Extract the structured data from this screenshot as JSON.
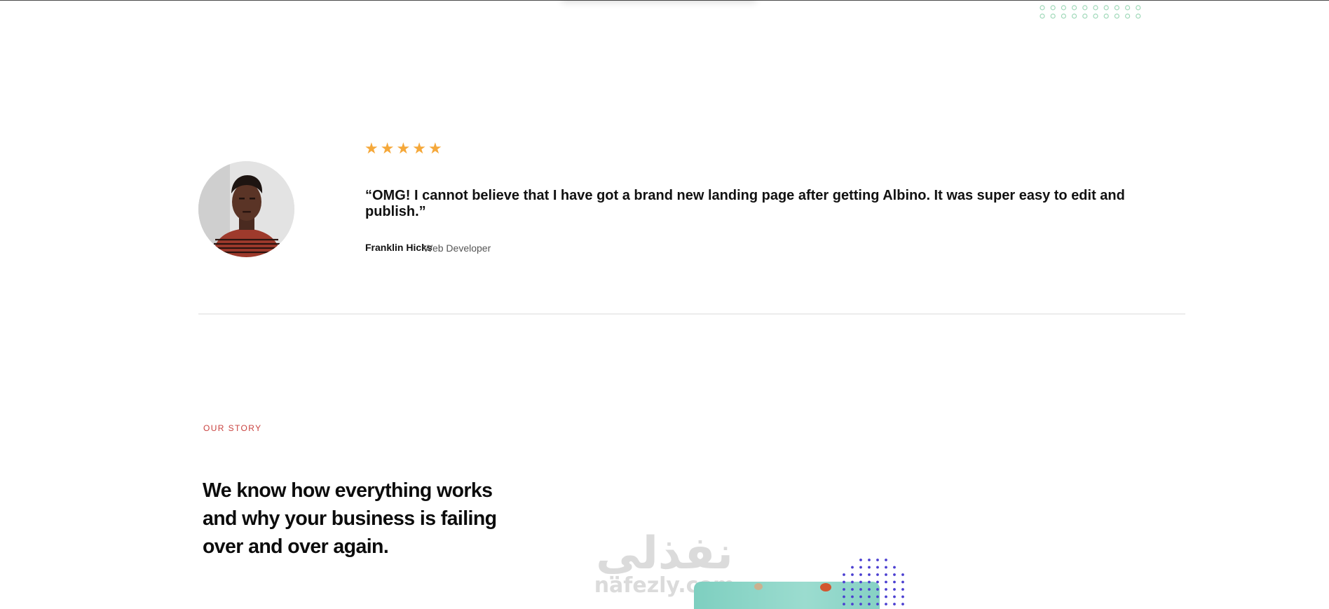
{
  "testimonial": {
    "rating": 5,
    "stars": [
      "★",
      "★",
      "★",
      "★",
      "★"
    ],
    "quote": "“OMG! I cannot believe that I have got a brand new landing page after getting Albino. It was super easy to edit and publish.”",
    "author_name": "Franklin Hicks",
    "author_role": "Web Developer"
  },
  "story": {
    "eyebrow": "OUR STORY",
    "headline": "We know how everything works and why your business is failing over and over again."
  },
  "watermark": {
    "arabic": "نفذلي",
    "latin": "nafezly.com"
  },
  "colors": {
    "star": "#f5a83a",
    "eyebrow": "#c9423f",
    "dot_green": "#9fd8b8",
    "dot_purple": "#4b3fd1",
    "image_teal": "#8fd6c8"
  }
}
